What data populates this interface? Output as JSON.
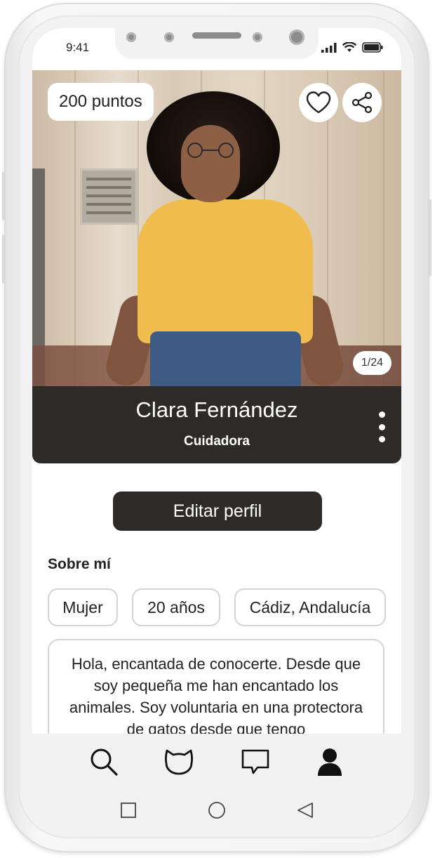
{
  "status_bar": {
    "time": "9:41"
  },
  "profile": {
    "points": "200 puntos",
    "photo_counter": "1/24",
    "name": "Clara Fernández",
    "role": "Cuidadora"
  },
  "actions": {
    "edit_profile": "Editar perfil"
  },
  "about": {
    "title": "Sobre mí",
    "chips": [
      "Mujer",
      "20 años",
      "Cádiz, Andalucía"
    ],
    "bio": "Hola, encantada de conocerte. Desde que soy pequeña me han encantado los animales. Soy voluntaria en una protectora de gatos desde que tengo"
  },
  "bottom_nav": {
    "items": [
      "search-icon",
      "cat-icon",
      "chat-icon",
      "profile-icon"
    ],
    "active": "profile-icon"
  },
  "system_nav": [
    "square-icon",
    "circle-icon",
    "back-triangle-icon"
  ],
  "colors": {
    "dark": "#2d2a27",
    "chip_border": "#d4d4d4",
    "nav_bg": "#f2f2f2"
  }
}
